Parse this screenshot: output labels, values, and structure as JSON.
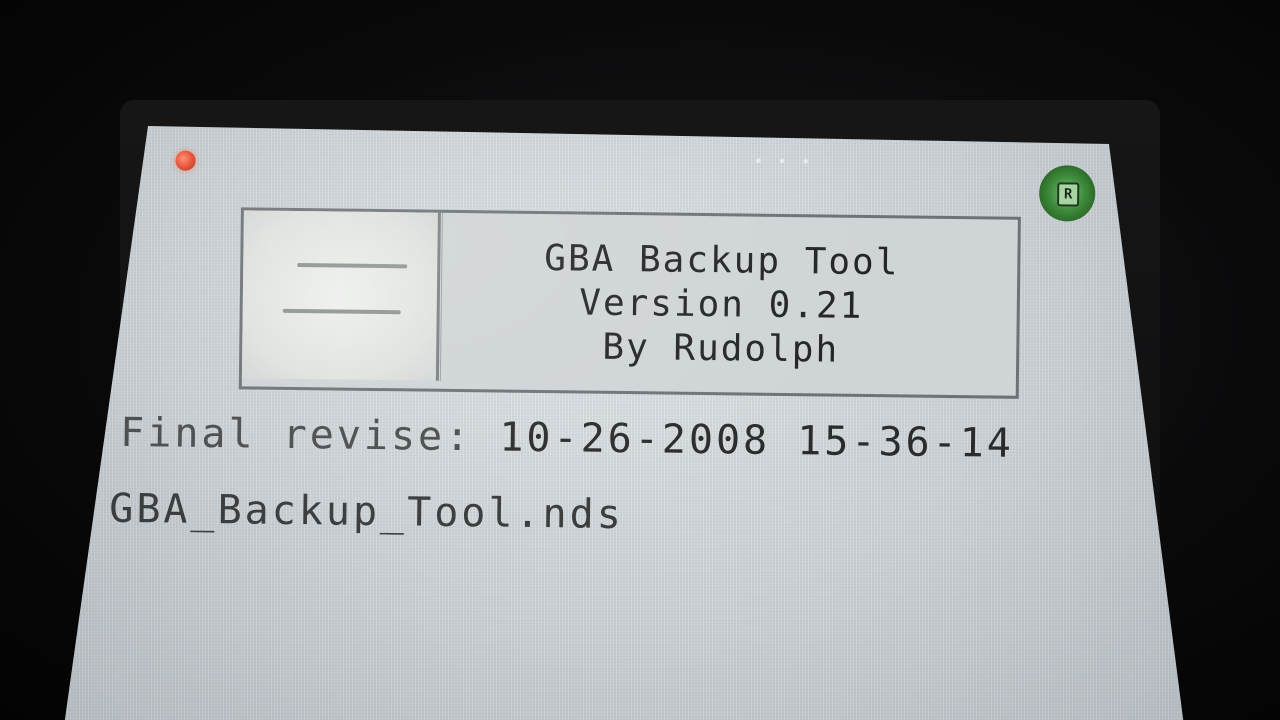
{
  "status": {
    "power_led_color": "#e2462c",
    "r_icon_label": "R",
    "r_icon_color": "#3d8a3a"
  },
  "header": {
    "icon": "cartridge-icon",
    "title": "GBA Backup Tool",
    "version": "Version 0.21",
    "author": "By Rudolph"
  },
  "info": {
    "revise_label": "Final revise:",
    "revise_value": "10-26-2008 15-36-14",
    "filename": "GBA_Backup_Tool.nds"
  }
}
